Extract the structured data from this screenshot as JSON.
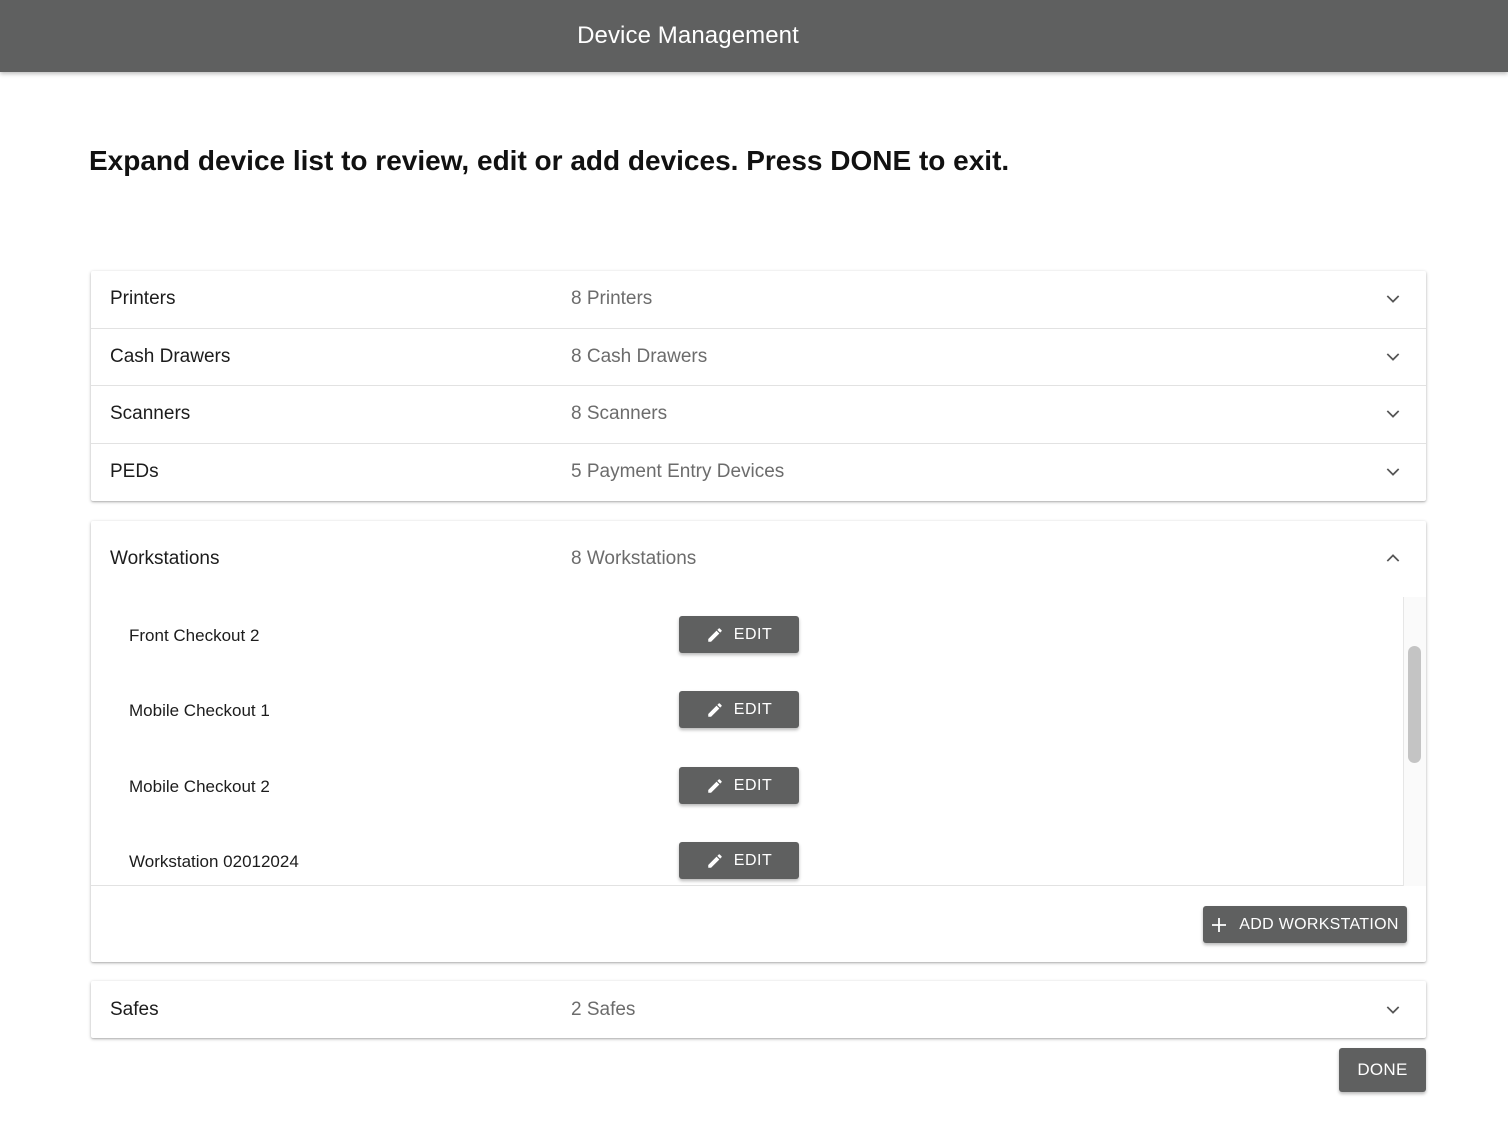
{
  "header": {
    "title": "Device Management"
  },
  "instructions": "Expand device list to review, edit or add devices. Press DONE to exit.",
  "device_groups": [
    {
      "label": "Printers",
      "count": "8 Printers",
      "expanded": false
    },
    {
      "label": "Cash Drawers",
      "count": "8 Cash Drawers",
      "expanded": false
    },
    {
      "label": "Scanners",
      "count": "8 Scanners",
      "expanded": false
    },
    {
      "label": "PEDs",
      "count": "5 Payment Entry Devices",
      "expanded": false
    }
  ],
  "workstations": {
    "label": "Workstations",
    "count": "8 Workstations",
    "expanded": true,
    "items": [
      {
        "name": "Front Checkout 2",
        "edit_label": "EDIT"
      },
      {
        "name": "Mobile Checkout 1",
        "edit_label": "EDIT"
      },
      {
        "name": "Mobile Checkout 2",
        "edit_label": "EDIT"
      },
      {
        "name": "Workstation 02012024",
        "edit_label": "EDIT"
      }
    ],
    "add_label": "ADD WORKSTATION"
  },
  "safes": {
    "label": "Safes",
    "count": "2 Safes",
    "expanded": false
  },
  "done_label": "DONE",
  "icons": {
    "expand": "chevron-down-icon",
    "collapse": "chevron-up-icon",
    "edit": "pencil-icon",
    "add": "plus-icon"
  },
  "colors": {
    "header_bg": "#5f6060",
    "button_bg": "#5f6060",
    "button_text": "#ffffff",
    "secondary_text": "#6c6c6c"
  }
}
